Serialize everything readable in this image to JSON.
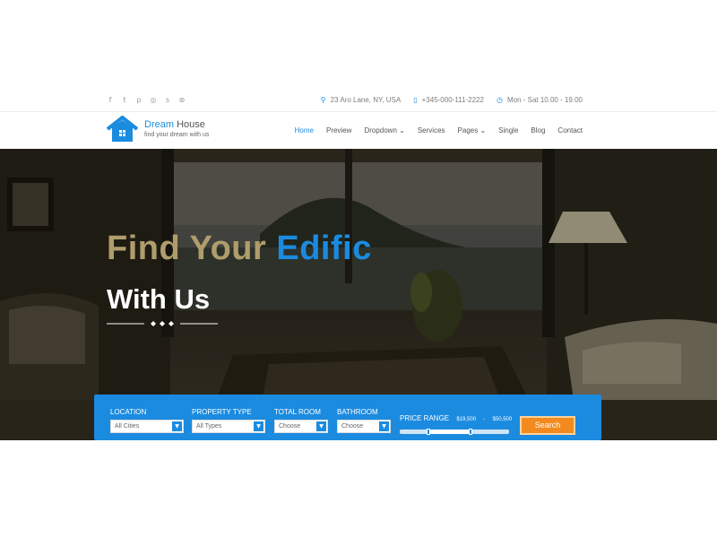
{
  "topbar": {
    "social": [
      {
        "icon": "facebook-icon",
        "glyph": "f"
      },
      {
        "icon": "twitter-icon",
        "glyph": "t"
      },
      {
        "icon": "pinterest-icon",
        "glyph": "p"
      },
      {
        "icon": "instagram-icon",
        "glyph": "◎"
      },
      {
        "icon": "skype-icon",
        "glyph": "s"
      },
      {
        "icon": "dribbble-icon",
        "glyph": "⊛"
      }
    ],
    "address": "23 Aro Lane, NY, USA",
    "phone": "+345-000-111-2222",
    "hours": "Mon - Sat 10.00 - 19.00"
  },
  "logo": {
    "name_part1": "Dream",
    "name_part2": "House",
    "tagline": "find your dream with us"
  },
  "nav": {
    "home": "Home",
    "preview": "Preview",
    "dropdown": "Dropdown",
    "services": "Services",
    "pages": "Pages",
    "single": "Single",
    "blog": "Blog",
    "contact": "Contact"
  },
  "hero": {
    "title_part1": "Find Your",
    "title_highlight": "Edific",
    "title_line2": "With Us"
  },
  "search": {
    "location_label": "LOCATION",
    "location_value": "All Cities",
    "type_label": "PROPERTY TYPE",
    "type_value": "All Types",
    "room_label": "TOTAL ROOM",
    "room_value": "Choose",
    "bath_label": "BATHROOM",
    "bath_value": "Choose",
    "price_label": "PRICE RANGE",
    "price_min": "$19,500",
    "price_max": "$50,500",
    "button": "Search"
  },
  "colors": {
    "accent": "#1b8be0",
    "gold": "#b09d6c",
    "button": "#f28a1f"
  }
}
